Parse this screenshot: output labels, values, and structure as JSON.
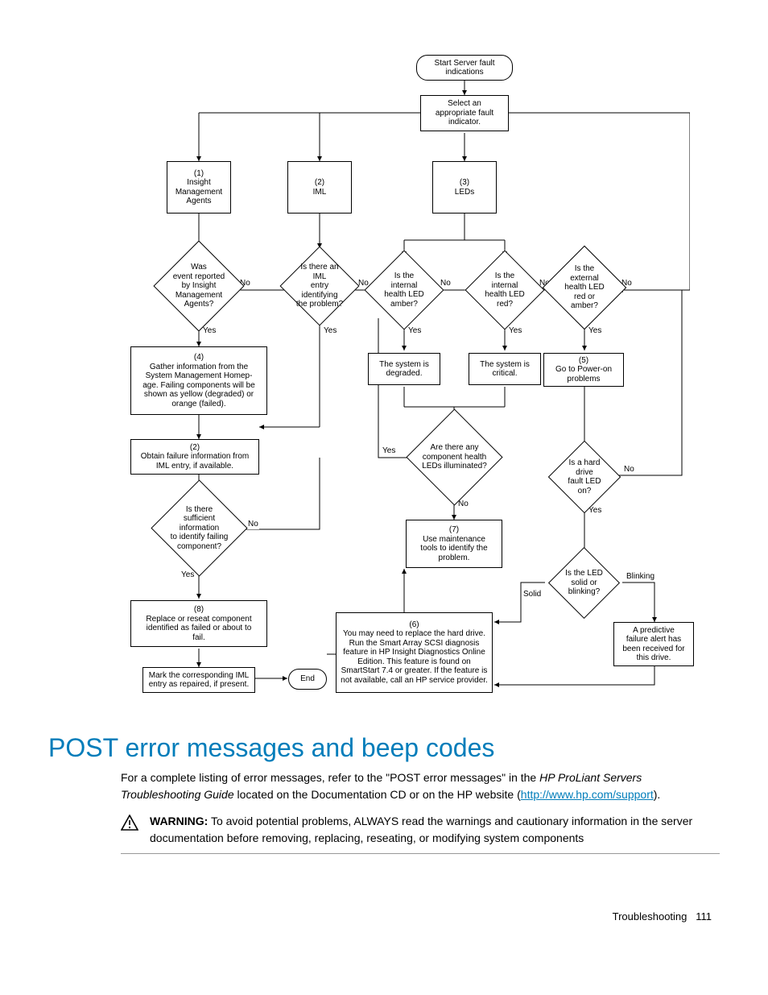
{
  "flow": {
    "n_start": "Start Server fault\nindications",
    "n_select": "Select an\nappropriate fault\nindicator.",
    "n_b1": "(1)\nInsight\nManagement\nAgents",
    "n_b2": "(2)\nIML",
    "n_b3": "(3)\nLEDs",
    "d_event": "Was\nevent reported\nby Insight\nManagement\nAgents?",
    "d_iml": "Is there an IML\nentry identifying\nthe problem?",
    "d_int_amber": "Is the\ninternal\nhealth LED\namber?",
    "d_int_red": "Is the\ninternal\nhealth LED\nred?",
    "d_ext": "Is the\nexternal\nhealth LED\nred or\namber?",
    "n_gather": "(4)\nGather information from the\nSystem Management Homep-\nage. Failing components will be\nshown as yellow (degraded) or\norange (failed).",
    "n_degraded": "The system is\ndegraded.",
    "n_critical": "The system is\ncritical.",
    "n_power": "(5)\nGo to Power-on\nproblems",
    "n_obtain": "(2)\nObtain failure information from\nIML entry, if available.",
    "d_comp_leds": "Are there any\ncomponent health\nLEDs illuminated?",
    "d_hdd": "Is a hard drive\nfault LED on?",
    "d_suff": "Is there\nsufficient information\nto identify failing\ncomponent?",
    "n_maint": "(7)\nUse maintenance\ntools to identify the\nproblem.",
    "d_solid": "Is the LED\nsolid or\nblinking?",
    "n_replace": "(8)\nReplace or reseat component\nidentified as failed or about to\nfail.",
    "n_six": "(6)\nYou may need to replace the hard drive.\nRun the Smart Array SCSI diagnosis\nfeature in HP Insight Diagnostics Online\nEdition. This feature is found on\nSmartStart 7.4 or greater. If the feature is\nnot available, call an HP service provider.",
    "n_predict": "A predictive\nfailure alert has\nbeen received for\nthis drive.",
    "n_mark": "Mark the corresponding IML\nentry as repaired, if present.",
    "n_end": "End",
    "lbl_yes": "Yes",
    "lbl_no": "No",
    "lbl_solid": "Solid",
    "lbl_blinking": "Blinking"
  },
  "section": {
    "heading": "POST error messages and beep codes",
    "p1a": "For a complete listing of error messages, refer to the \"POST error messages\" in the ",
    "p1b": "HP ProLiant Servers Troubleshooting Guide",
    "p1c": " located on the Documentation CD or on the HP website (",
    "link": "http://www.hp.com/support",
    "p1d": ").",
    "warn_lead": "WARNING:",
    "warn_body": "  To avoid potential problems, ALWAYS read the warnings and cautionary information in the server documentation before removing, replacing, reseating, or modifying system components"
  },
  "footer": {
    "section": "Troubleshooting",
    "page": "111"
  }
}
